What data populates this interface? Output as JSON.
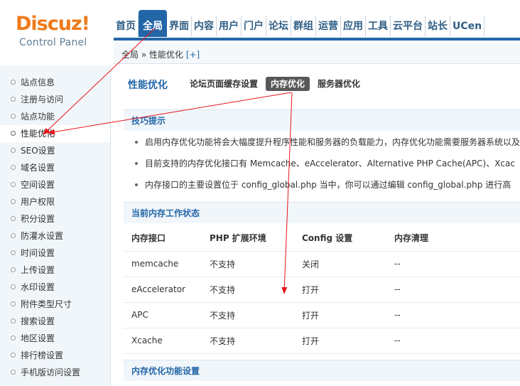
{
  "header": {
    "logo_main": "Discuz!",
    "logo_sub": "Control Panel",
    "nav": [
      {
        "label": "首页",
        "active": false
      },
      {
        "label": "全局",
        "active": true
      },
      {
        "label": "界面",
        "active": false
      },
      {
        "label": "内容",
        "active": false
      },
      {
        "label": "用户",
        "active": false
      },
      {
        "label": "门户",
        "active": false
      },
      {
        "label": "论坛",
        "active": false
      },
      {
        "label": "群组",
        "active": false
      },
      {
        "label": "运营",
        "active": false
      },
      {
        "label": "应用",
        "active": false
      },
      {
        "label": "工具",
        "active": false
      },
      {
        "label": "云平台",
        "active": false
      },
      {
        "label": "站长",
        "active": false
      },
      {
        "label": "UCen",
        "active": false
      }
    ]
  },
  "breadcrumb": {
    "text": "全局 » 性能优化",
    "plus": "[+]"
  },
  "sidebar": {
    "items": [
      {
        "label": "站点信息",
        "active": false
      },
      {
        "label": "注册与访问",
        "active": false
      },
      {
        "label": "站点功能",
        "active": false
      },
      {
        "label": "性能优化",
        "active": true
      },
      {
        "label": "SEO设置",
        "active": false
      },
      {
        "label": "域名设置",
        "active": false
      },
      {
        "label": "空间设置",
        "active": false
      },
      {
        "label": "用户权限",
        "active": false
      },
      {
        "label": "积分设置",
        "active": false
      },
      {
        "label": "防灌水设置",
        "active": false
      },
      {
        "label": "时间设置",
        "active": false
      },
      {
        "label": "上传设置",
        "active": false
      },
      {
        "label": "水印设置",
        "active": false
      },
      {
        "label": "附件类型尺寸",
        "active": false
      },
      {
        "label": "搜索设置",
        "active": false
      },
      {
        "label": "地区设置",
        "active": false
      },
      {
        "label": "排行榜设置",
        "active": false
      },
      {
        "label": "手机版访问设置",
        "active": false
      }
    ]
  },
  "main": {
    "title": "性能优化",
    "tabs": [
      {
        "label": "论坛页面缓存设置",
        "active": false
      },
      {
        "label": "内存优化",
        "active": true
      },
      {
        "label": "服务器优化",
        "active": false
      }
    ],
    "tips_header": "技巧提示",
    "tips": [
      "启用内存优化功能将会大幅度提升程序性能和服务器的负载能力，内存优化功能需要服务器系统以及",
      "目前支持的内存优化接口有 Memcache、eAccelerator、Alternative PHP Cache(APC)、Xcac",
      "内存接口的主要设置位于 config_global.php 当中，你可以通过编辑 config_global.php 进行高"
    ],
    "status_header": "当前内存工作状态",
    "table": {
      "headers": [
        "内存接口",
        "PHP 扩展环境",
        "Config 设置",
        "内存清理"
      ],
      "rows": [
        [
          "memcache",
          "不支持",
          "关闭",
          "--"
        ],
        [
          "eAccelerator",
          "不支持",
          "打开",
          "--"
        ],
        [
          "APC",
          "不支持",
          "打开",
          "--"
        ],
        [
          "Xcache",
          "不支持",
          "打开",
          "--"
        ]
      ]
    },
    "settings_header": "内存优化功能设置"
  },
  "colors": {
    "accent": "#2366a8",
    "logo": "#ee7a1b",
    "annotation": "#e8141b"
  }
}
